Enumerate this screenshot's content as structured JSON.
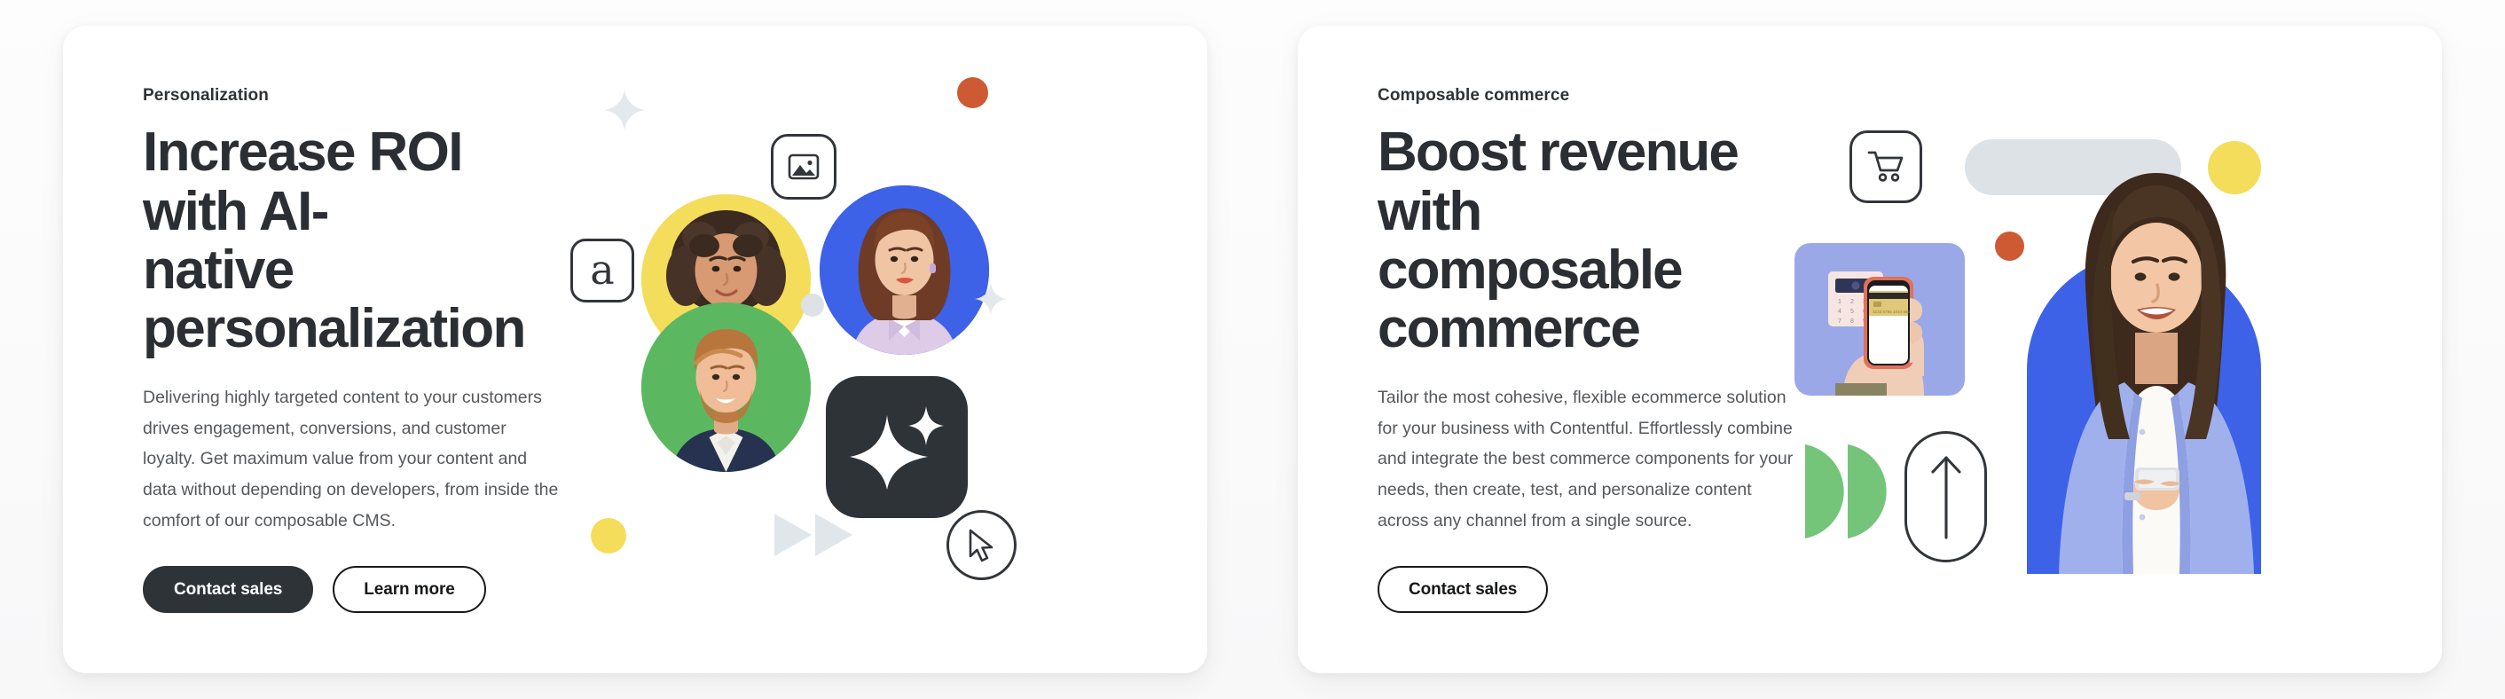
{
  "page": {
    "background_color": "#fbfbfb",
    "card_background": "#ffffff",
    "layout": "two side-by-side marketing cards"
  },
  "palette": {
    "ink": "#2b2f33",
    "body_text": "#55585c",
    "button_solid_bg": "#2e3338",
    "yellow": "#f4dd5a",
    "orange": "#cd5a33",
    "blue": "#3d62e8",
    "green": "#5cb860",
    "green_light": "#74c47a",
    "pale_gray": "#dde2e6",
    "periwinkle": "#9aa8e8",
    "lavender_shirt": "#9fb0ec",
    "red_shirt": "#d6452e",
    "lilac_shirt": "#ddcbe8",
    "navy_shirt": "#26324f"
  },
  "cards": [
    {
      "id": "personalization",
      "eyebrow": "Personalization",
      "headline": "Increase ROI with AI-\nnative personalization",
      "body": "Delivering highly targeted content to your customers drives engagement, conversions, and customer loyalty. Get maximum value from your content and data without depending on developers, from inside the comfort of our composable CMS.",
      "buttons": [
        {
          "label": "Contact sales",
          "style": "solid"
        },
        {
          "label": "Learn more",
          "style": "outline"
        }
      ],
      "illustration": {
        "name": "personalization-collage",
        "elements": [
          {
            "name": "image-icon-tile",
            "type": "outline-rounded-square",
            "icon": "image-icon"
          },
          {
            "name": "letter-a-tile",
            "type": "outline-rounded-square",
            "icon": "letter-a-glyph",
            "glyph": "a"
          },
          {
            "name": "ai-sparkle-tile",
            "type": "dark-rounded-square",
            "icon": "sparkle-icon"
          },
          {
            "name": "cursor-icon-circle",
            "type": "outline-circle",
            "icon": "cursor-arrow-icon"
          },
          {
            "name": "avatar-yellow",
            "type": "avatar",
            "background": "#f4dd5a"
          },
          {
            "name": "avatar-blue",
            "type": "avatar",
            "background": "#3d62e8"
          },
          {
            "name": "avatar-green",
            "type": "avatar",
            "background": "#5cb860"
          },
          {
            "name": "dot-orange",
            "type": "circle",
            "color": "#cd5a33"
          },
          {
            "name": "dot-yellow",
            "type": "circle",
            "color": "#f4dd5a"
          },
          {
            "name": "dot-gray",
            "type": "circle",
            "color": "#dde2e6"
          },
          {
            "name": "sparkle-top-left",
            "type": "sparkle",
            "color": "#e4e9ee"
          },
          {
            "name": "sparkle-right",
            "type": "sparkle",
            "color": "#e4e9ee"
          },
          {
            "name": "fast-forward-arrows",
            "type": "double-triangle",
            "color": "#e1e6ea"
          }
        ]
      }
    },
    {
      "id": "composable-commerce",
      "eyebrow": "Composable commerce",
      "headline": "Boost revenue with\ncomposable commerce",
      "body": "Tailor the most cohesive, flexible ecommerce solution for your business with Contentful. Effortlessly combine and integrate the best commerce components for your needs, then create, test, and personalize content across any channel from a single source.",
      "buttons": [
        {
          "label": "Contact sales",
          "style": "outline"
        }
      ],
      "illustration": {
        "name": "commerce-collage",
        "elements": [
          {
            "name": "shopping-cart-tile",
            "type": "outline-rounded-square",
            "icon": "shopping-cart-icon"
          },
          {
            "name": "gray-pill-placeholder",
            "type": "pill",
            "color": "#dde2e6"
          },
          {
            "name": "dot-yellow",
            "type": "circle",
            "color": "#f4dd5a"
          },
          {
            "name": "dot-orange",
            "type": "circle",
            "color": "#cd5a33"
          },
          {
            "name": "payment-terminal-photo",
            "type": "photo-tile",
            "background": "#9aa8e8"
          },
          {
            "name": "green-half-circles",
            "type": "double-half-circle",
            "color": "#74c47a"
          },
          {
            "name": "up-arrow-pill",
            "type": "outline-pill",
            "icon": "arrow-up-icon"
          },
          {
            "name": "woman-with-phone-photo",
            "type": "portrait",
            "background": "#3d62e8"
          }
        ]
      }
    }
  ]
}
